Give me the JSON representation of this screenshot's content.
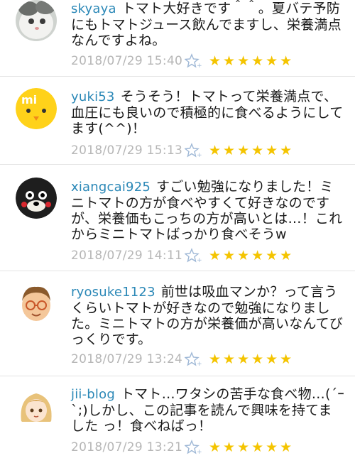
{
  "comments": [
    {
      "username": "skyaya",
      "text": "トマト大好きです＾＾。夏バテ予防にもトマトジュース飲んでますし、栄養満点なんですよね。",
      "time": "2018/07/29 15:40",
      "avatar": "cat-avatar"
    },
    {
      "username": "yuki53",
      "text": "そうそう！トマトって栄養満点で、血圧にも良いので積極的に食べるようにしてます(^^)！",
      "time": "2018/07/29 15:13",
      "avatar": "chick-avatar"
    },
    {
      "username": "xiangcai925",
      "text": "すごい勉強になりました！ミニトマトの方が食べやすくて好きなのですが、栄養価もこっちの方が高いとは…！これからミニトマトばっかり食べそうw",
      "time": "2018/07/29 14:11",
      "avatar": "bear-avatar"
    },
    {
      "username": "ryosuke1123",
      "text": "前世は吸血マンか？って言うくらいトマトが好きなので勉強になりました。ミニトマトの方が栄養価が高いなんてびっくりです。",
      "time": "2018/07/29 13:24",
      "avatar": "boy-avatar"
    },
    {
      "username": "jii-blog",
      "text": "トマト…ワタシの苦手な食べ物…(´ｰ`;)しかし、この記事を読んで興味を持てました っ！食べねばっ！",
      "time": "2018/07/29 13:21",
      "avatar": "girl-avatar"
    }
  ],
  "rating": {
    "stars": "★★★★★★",
    "star_color": "#f4c400",
    "favorite_icon": "star-plus-icon"
  },
  "colors": {
    "username": "#2b88b7",
    "timestamp": "#b6b6b6"
  }
}
